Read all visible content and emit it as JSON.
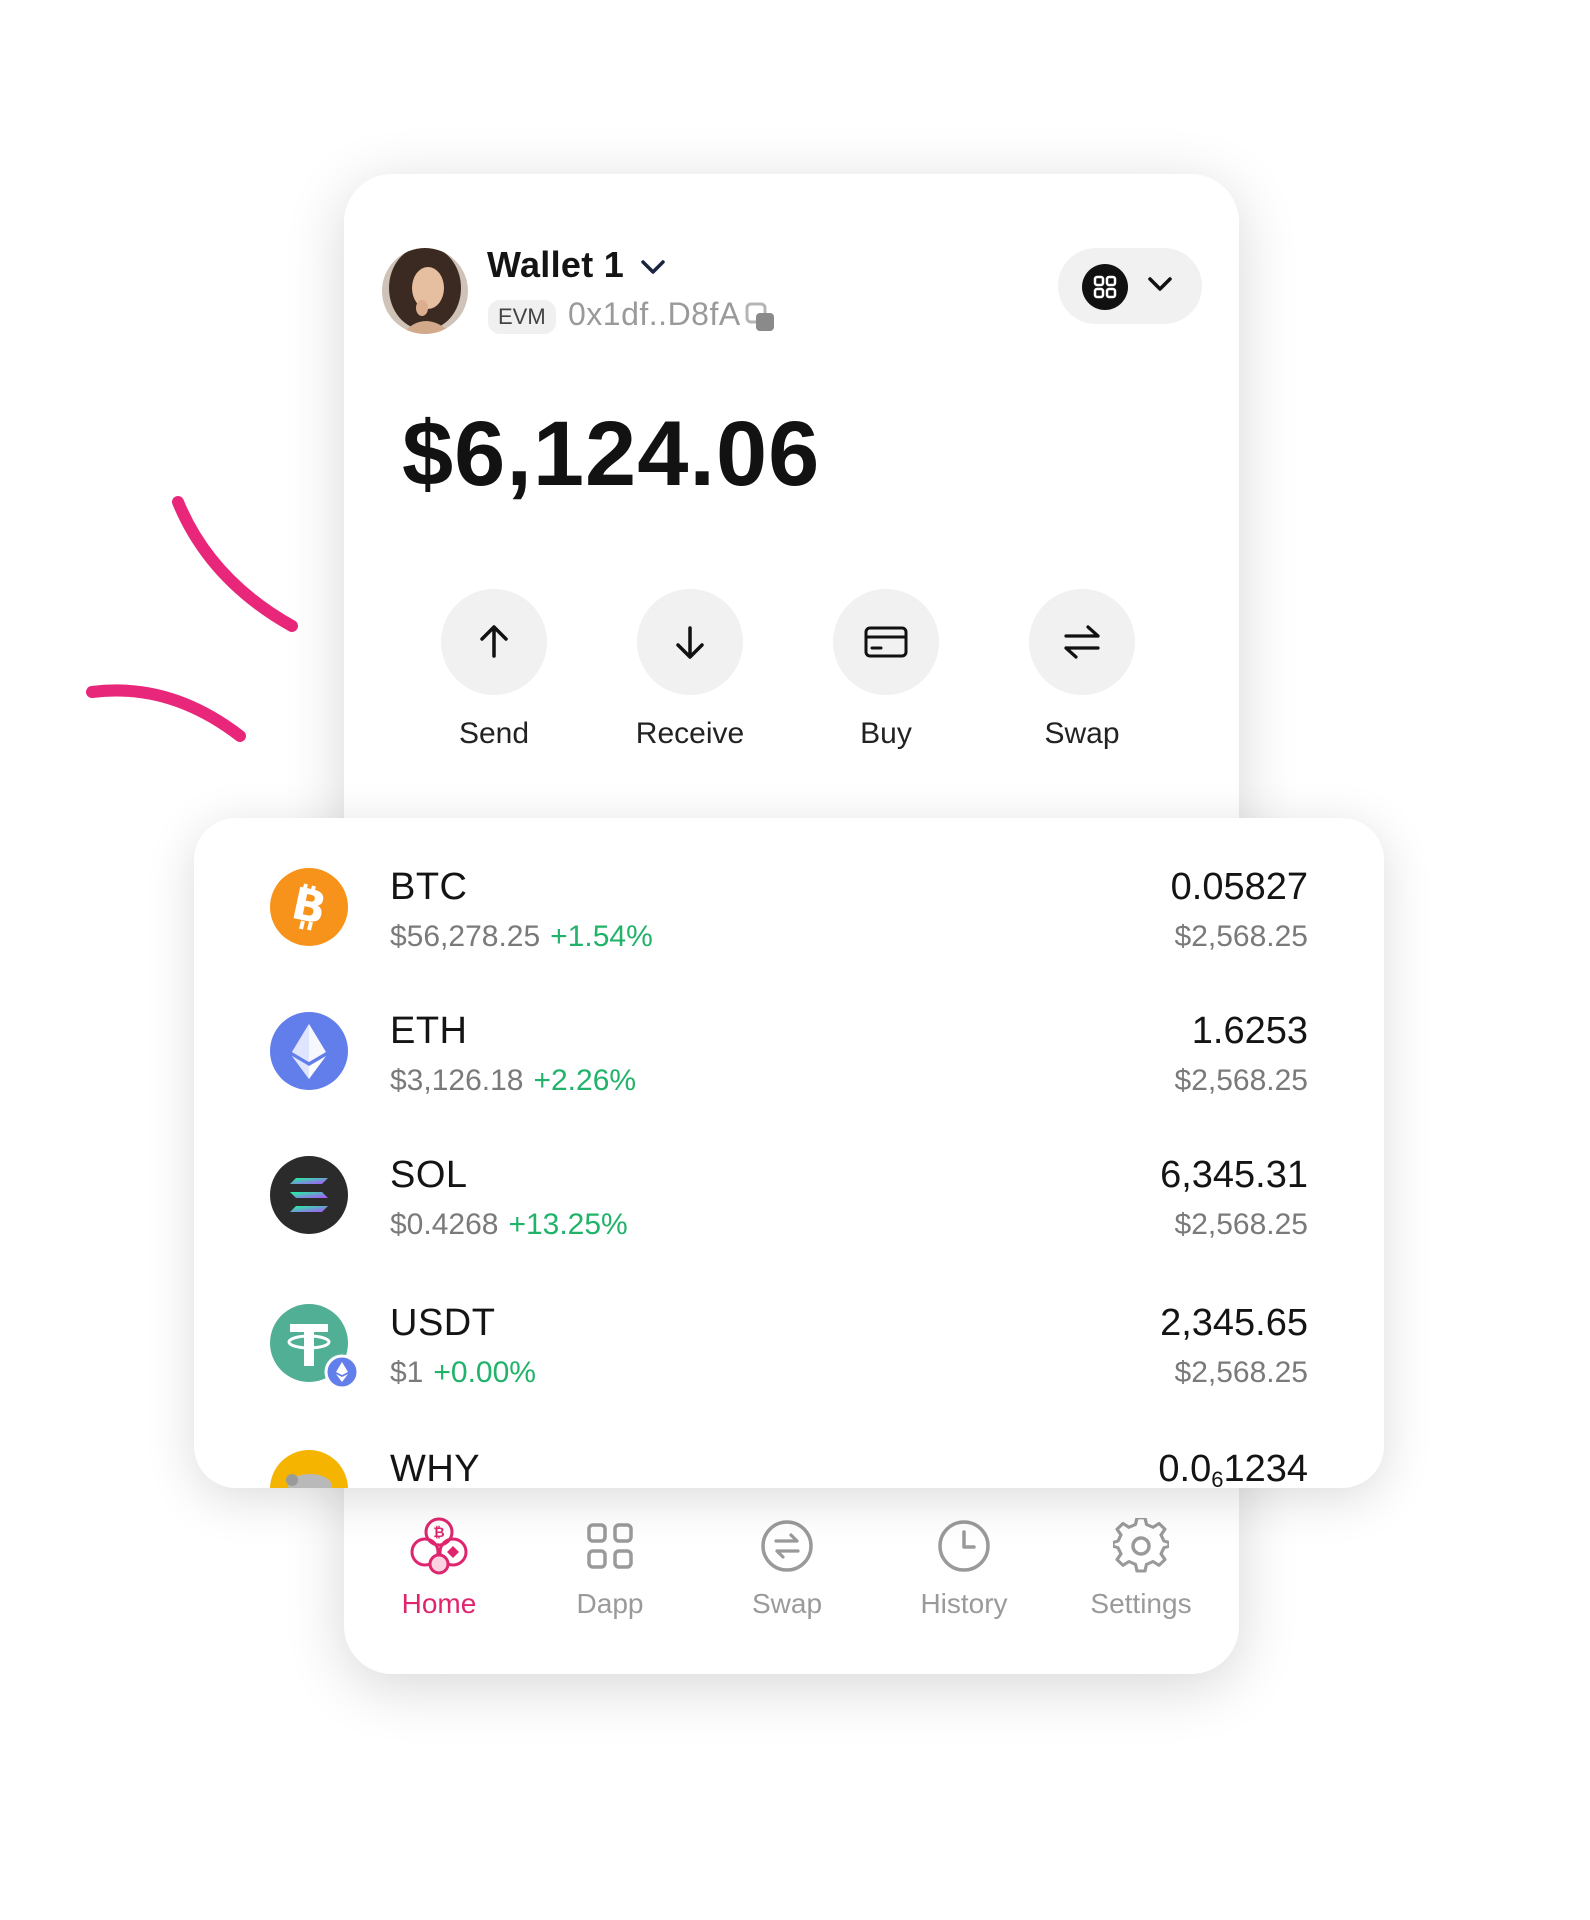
{
  "wallet": {
    "name": "Wallet 1",
    "network_badge": "EVM",
    "address": "0x1df..D8fA",
    "balance": "$6,124.06"
  },
  "actions": [
    {
      "label": "Send",
      "icon": "arrow-up-icon"
    },
    {
      "label": "Receive",
      "icon": "arrow-down-icon"
    },
    {
      "label": "Buy",
      "icon": "card-icon"
    },
    {
      "label": "Swap",
      "icon": "swap-arrows-icon"
    }
  ],
  "tokens": [
    {
      "symbol": "BTC",
      "price": "$56,278.25",
      "change": "+1.54%",
      "amount": "0.05827",
      "value": "$2,568.25",
      "color": "#f7931a"
    },
    {
      "symbol": "ETH",
      "price": "$3,126.18",
      "change": "+2.26%",
      "amount": "1.6253",
      "value": "$2,568.25",
      "color": "#627eea"
    },
    {
      "symbol": "SOL",
      "price": "$0.4268",
      "change": "+13.25%",
      "amount": "6,345.31",
      "value": "$2,568.25",
      "color": "#2b2b2b"
    },
    {
      "symbol": "USDT",
      "price": "$1",
      "change": "+0.00%",
      "amount": "2,345.65",
      "value": "$2,568.25",
      "color": "#50af95"
    },
    {
      "symbol": "WHY",
      "amount_prefix": "0.0",
      "amount_sub": "6",
      "amount_rest": "1234",
      "color": "#f5b400"
    }
  ],
  "nav": [
    {
      "label": "Home",
      "icon": "home-icon",
      "active": true
    },
    {
      "label": "Dapp",
      "icon": "dapp-grid-icon"
    },
    {
      "label": "Swap",
      "icon": "swap-circle-icon"
    },
    {
      "label": "History",
      "icon": "clock-icon"
    },
    {
      "label": "Settings",
      "icon": "gear-icon"
    }
  ],
  "colors": {
    "accent": "#e0256f",
    "positive": "#22b36b",
    "muted": "#9a9a9a"
  }
}
